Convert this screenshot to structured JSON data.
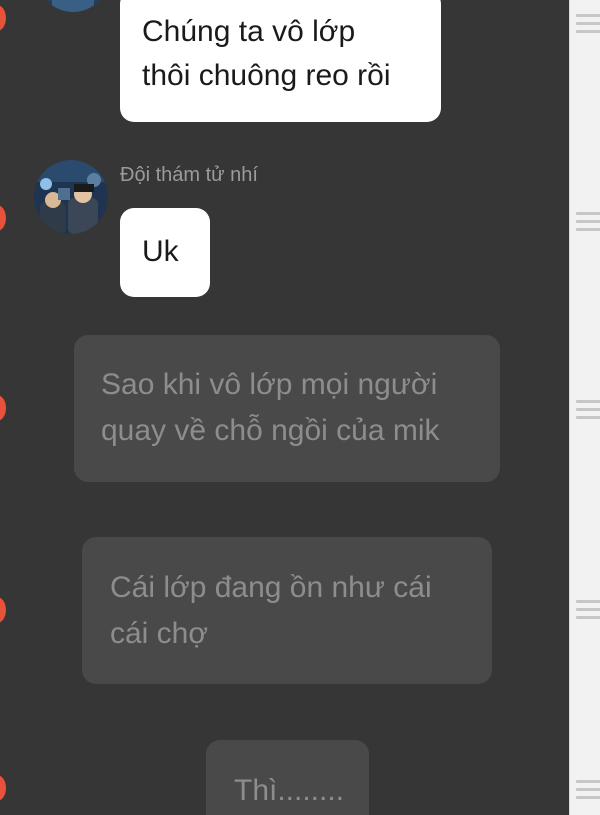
{
  "chat": {
    "sender_name": "Đội thám tử nhí",
    "messages": [
      {
        "style": "white",
        "lines": [
          "Chúng ta vô lớp",
          "thôi chuông reo rồi"
        ]
      },
      {
        "style": "white",
        "lines": [
          "Uk"
        ]
      },
      {
        "style": "dark",
        "lines": [
          "Sao khi vô lớp mọi người",
          "quay về chỗ ngồi của mik"
        ]
      },
      {
        "style": "dark",
        "lines": [
          "Cái lớp đang ồn như cái",
          "cái chợ"
        ]
      },
      {
        "style": "dark",
        "lines": [
          "Thì........"
        ]
      }
    ]
  },
  "colors": {
    "chat_background": "#363636",
    "white_bubble": "#ffffff",
    "dark_bubble": "#494949",
    "dark_bubble_text": "#8d8d8d",
    "sender_name_text": "#9b9b9b",
    "edge_dot": "#e8513a",
    "rail_background": "#f2f2f2"
  },
  "icons": {
    "rail_handle": "drag-handle-icon",
    "edge_marker": "orange-dot-icon"
  }
}
